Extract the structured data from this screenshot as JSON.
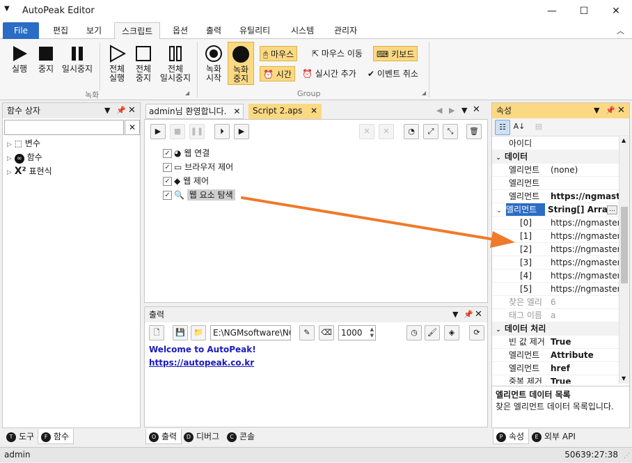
{
  "app": {
    "title": "AutoPeak Editor"
  },
  "window_controls": {
    "minimize": "—",
    "maximize": "☐",
    "close": "✕"
  },
  "menu": {
    "tabs": [
      "File",
      "편집",
      "보기",
      "스크립트",
      "옵션",
      "출력",
      "유틸리티",
      "시스템",
      "관리자"
    ],
    "active": "스크립트"
  },
  "ribbon": {
    "recording_group": {
      "label": "녹화",
      "buttons": [
        {
          "label1": "실행",
          "label2": "",
          "icon": "play-icon"
        },
        {
          "label1": "중지",
          "label2": "",
          "icon": "stop-icon"
        },
        {
          "label1": "일시중지",
          "label2": "",
          "icon": "pause-icon"
        },
        {
          "label1": "전체",
          "label2": "실행",
          "icon": "play-outline-icon"
        },
        {
          "label1": "전체",
          "label2": "중지",
          "icon": "stop-outline-icon"
        },
        {
          "label1": "전체",
          "label2": "일시중지",
          "icon": "pause-outline-icon"
        }
      ]
    },
    "group2": {
      "label": "Group",
      "record_start": {
        "label1": "녹화",
        "label2": "시작"
      },
      "record_stop": {
        "label1": "녹화",
        "label2": "중지"
      },
      "mouse": "마우스",
      "mouse_move": "마우스 이동",
      "keyboard": "키보드",
      "time": "시간",
      "realtime_add": "실시간 추가",
      "event_cancel": "이벤트 취소"
    }
  },
  "function_panel": {
    "title": "함수 상자",
    "search_value": "",
    "tree": [
      {
        "label": "변수",
        "icon": "variable-icon"
      },
      {
        "label": "함수",
        "icon": "function-icon"
      },
      {
        "label": "표현식",
        "icon": "expression-icon"
      }
    ],
    "bottom_tabs": [
      {
        "badge": "T",
        "label": "도구"
      },
      {
        "badge": "F",
        "label": "함수"
      }
    ]
  },
  "editor": {
    "tabs": [
      {
        "label": "admin님 환영합니다."
      },
      {
        "label": "Script 2.aps"
      }
    ],
    "items": [
      {
        "label": "웹 연결",
        "checked": true,
        "icon": "globe-icon"
      },
      {
        "label": "브라우저 제어",
        "checked": true,
        "icon": "browser-window-icon"
      },
      {
        "label": "웹 제어",
        "checked": true,
        "icon": "navigate-icon"
      },
      {
        "label": "웹 요소 탐색",
        "checked": true,
        "icon": "magnifier-icon",
        "selected": true
      }
    ]
  },
  "output": {
    "title": "출력",
    "path": "E:\\NGMsoftware\\NG",
    "count": "1000",
    "lines": [
      "Welcome to AutoPeak!",
      "https://autopeak.co.kr"
    ],
    "bottom_tabs": [
      {
        "badge": "O",
        "label": "출력"
      },
      {
        "badge": "D",
        "label": "디버그"
      },
      {
        "badge": "C",
        "label": "콘솔"
      }
    ]
  },
  "properties": {
    "title": "속성",
    "rows": [
      {
        "type": "row",
        "key": "아이디",
        "value": ""
      },
      {
        "type": "cat",
        "key": "데이터"
      },
      {
        "type": "row",
        "key": "엘리먼트",
        "value": "(none)"
      },
      {
        "type": "row",
        "key": "엘리먼트",
        "value": ""
      },
      {
        "type": "row",
        "key": "엘리먼트",
        "value": "https://ngmaste",
        "bold": true
      },
      {
        "type": "cat-sel",
        "key": "엘리먼트",
        "value": "String[] Array",
        "bold": true
      },
      {
        "type": "sub",
        "key": "[0]",
        "value": "https://ngmaster.t"
      },
      {
        "type": "sub",
        "key": "[1]",
        "value": "https://ngmaster.t"
      },
      {
        "type": "sub",
        "key": "[2]",
        "value": "https://ngmaster.t"
      },
      {
        "type": "sub",
        "key": "[3]",
        "value": "https://ngmaster.t"
      },
      {
        "type": "sub",
        "key": "[4]",
        "value": "https://ngmaster.t"
      },
      {
        "type": "sub",
        "key": "[5]",
        "value": "https://ngmaster.t"
      },
      {
        "type": "gray",
        "key": "찾은 엘리",
        "value": "6"
      },
      {
        "type": "gray",
        "key": "태그 이름",
        "value": "a"
      },
      {
        "type": "cat",
        "key": "데이터 처리"
      },
      {
        "type": "row",
        "key": "빈 값 제거",
        "value": "True",
        "bold": true
      },
      {
        "type": "row",
        "key": "엘리먼트",
        "value": "Attribute",
        "bold": true
      },
      {
        "type": "row",
        "key": "엘리먼트",
        "value": "href",
        "bold": true
      },
      {
        "type": "row",
        "key": "중복 제거",
        "value": "True",
        "bold": true
      }
    ],
    "desc_title": "엘리먼트 데이터 목록",
    "desc_text": "찾은 엘리먼트 데이터 목록입니다.",
    "bottom_tabs": [
      {
        "badge": "P",
        "label": "속성"
      },
      {
        "badge": "E",
        "label": "외부 API"
      }
    ]
  },
  "status": {
    "user": "admin",
    "time": "50639:27:38"
  },
  "colors": {
    "accent": "#2b6cc4",
    "highlight": "#fbd983",
    "arrow": "#ef7a2a",
    "link": "#1a1ac0"
  }
}
